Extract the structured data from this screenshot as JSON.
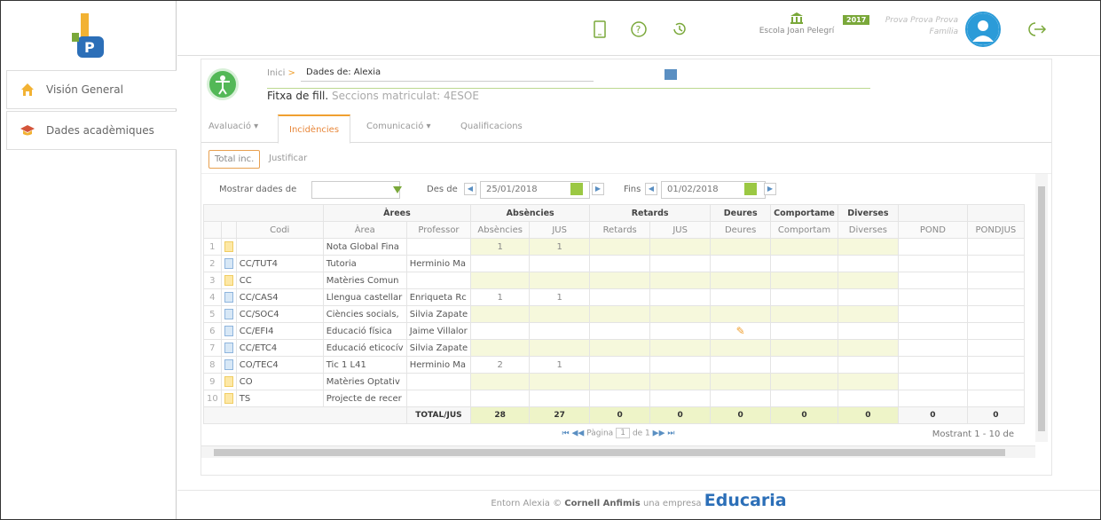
{
  "sidebar": {
    "logo_text": "JP",
    "items": [
      {
        "label": "Visión General",
        "icon": "home-icon"
      },
      {
        "label": "Dades acadèmiques",
        "icon": "graduation-cap-icon"
      }
    ]
  },
  "topbar": {
    "icons": [
      "tablet-icon",
      "help-icon",
      "history-icon",
      "logout-icon"
    ],
    "school_name": "Escola Joan Pelegrí",
    "year_badge": "2017",
    "user_name": "Prova Prova Prova",
    "user_role": "Família"
  },
  "breadcrumb": {
    "home": "Inici",
    "separator": ">",
    "student_label": "Dades de: Alexia"
  },
  "fitxa": {
    "title": "Fitxa de fill.",
    "subtitle": "Seccions matriculat: 4ESOE"
  },
  "tabs": [
    {
      "label": "Avaluació ▾",
      "active": false
    },
    {
      "label": "Incidències",
      "active": true
    },
    {
      "label": "Comunicació ▾",
      "active": false
    },
    {
      "label": "Qualificacions",
      "active": false
    }
  ],
  "subtabs": [
    {
      "label": "Total inc.",
      "active": true
    },
    {
      "label": "Justificar",
      "active": false
    }
  ],
  "filter": {
    "show_label": "Mostrar dades de",
    "show_value": "",
    "from_label": "Des de",
    "from_date": "25/01/2018",
    "to_label": "Fins",
    "to_date": "01/02/2018"
  },
  "grid": {
    "group_headers": {
      "arees": "Àrees",
      "absencies": "Absències",
      "retards": "Retards",
      "deures": "Deures",
      "comport": "Comportame",
      "diverses": "Diverses"
    },
    "columns": [
      "",
      "",
      "Codi",
      "Àrea",
      "Professor",
      "Absències",
      "JUS",
      "Retards",
      "JUS",
      "Deures",
      "Comportam",
      "Diverses",
      "POND",
      "PONDJUS"
    ],
    "rows": [
      {
        "n": "1",
        "icon": "yellow",
        "codi": "",
        "area": "Nota Global Fina",
        "prof": "",
        "abs": "1",
        "jus": "1",
        "ret": "",
        "rjus": "",
        "deures": "",
        "comp": "",
        "div": "",
        "pond": "",
        "pondjus": ""
      },
      {
        "n": "2",
        "icon": "blue",
        "codi": "CC/TUT4",
        "area": "Tutoria",
        "prof": "Herminio Ma",
        "abs": "",
        "jus": "",
        "ret": "",
        "rjus": "",
        "deures": "",
        "comp": "",
        "div": "",
        "pond": "",
        "pondjus": ""
      },
      {
        "n": "3",
        "icon": "yellow",
        "codi": "CC",
        "area": "Matèries Comun",
        "prof": "",
        "abs": "",
        "jus": "",
        "ret": "",
        "rjus": "",
        "deures": "",
        "comp": "",
        "div": "",
        "pond": "",
        "pondjus": ""
      },
      {
        "n": "4",
        "icon": "blue",
        "codi": "CC/CAS4",
        "area": "Llengua castellar",
        "prof": "Enriqueta Rc",
        "abs": "1",
        "jus": "1",
        "ret": "",
        "rjus": "",
        "deures": "",
        "comp": "",
        "div": "",
        "pond": "",
        "pondjus": ""
      },
      {
        "n": "5",
        "icon": "blue",
        "codi": "CC/SOC4",
        "area": "Ciències socials,",
        "prof": "Silvia Zapate",
        "abs": "",
        "jus": "",
        "ret": "",
        "rjus": "",
        "deures": "",
        "comp": "",
        "div": "",
        "pond": "",
        "pondjus": ""
      },
      {
        "n": "6",
        "icon": "blue",
        "codi": "CC/EFI4",
        "area": "Educació física",
        "prof": "Jaime Villalor",
        "abs": "",
        "jus": "",
        "ret": "",
        "rjus": "",
        "deures": "edit",
        "comp": "",
        "div": "",
        "pond": "",
        "pondjus": ""
      },
      {
        "n": "7",
        "icon": "blue",
        "codi": "CC/ETC4",
        "area": "Educació eticocív",
        "prof": "Silvia Zapate",
        "abs": "",
        "jus": "",
        "ret": "",
        "rjus": "",
        "deures": "",
        "comp": "",
        "div": "",
        "pond": "",
        "pondjus": ""
      },
      {
        "n": "8",
        "icon": "blue",
        "codi": "CO/TEC4",
        "area": "Tic 1 L41",
        "prof": "Herminio Ma",
        "abs": "2",
        "jus": "1",
        "ret": "",
        "rjus": "",
        "deures": "",
        "comp": "",
        "div": "",
        "pond": "",
        "pondjus": ""
      },
      {
        "n": "9",
        "icon": "yellow",
        "codi": "CO",
        "area": "Matèries Optativ",
        "prof": "",
        "abs": "",
        "jus": "",
        "ret": "",
        "rjus": "",
        "deures": "",
        "comp": "",
        "div": "",
        "pond": "",
        "pondjus": ""
      },
      {
        "n": "10",
        "icon": "yellow",
        "codi": "TS",
        "area": "Projecte de recer",
        "prof": "",
        "abs": "",
        "jus": "",
        "ret": "",
        "rjus": "",
        "deures": "",
        "comp": "",
        "div": "",
        "pond": "",
        "pondjus": ""
      }
    ],
    "totals": {
      "label": "TOTAL/JUS",
      "abs": "28",
      "jus": "27",
      "ret": "0",
      "rjus": "0",
      "deures": "0",
      "comp": "0",
      "div": "0",
      "pond": "0",
      "pondjus": "0"
    },
    "pager": {
      "label": "Pàgina",
      "page": "1",
      "of": "de 1"
    },
    "count_text": "Mostrant 1 - 10 de"
  },
  "footer": {
    "prefix": "Entorn Alexia ©",
    "company": "Cornell Anfimis",
    "mid": "una empresa",
    "brand": "Educaria"
  },
  "colors": {
    "accent_orange": "#e8873a",
    "green": "#7aa83a",
    "blue": "#2b9bd8",
    "brand_blue": "#2c6fb8"
  }
}
